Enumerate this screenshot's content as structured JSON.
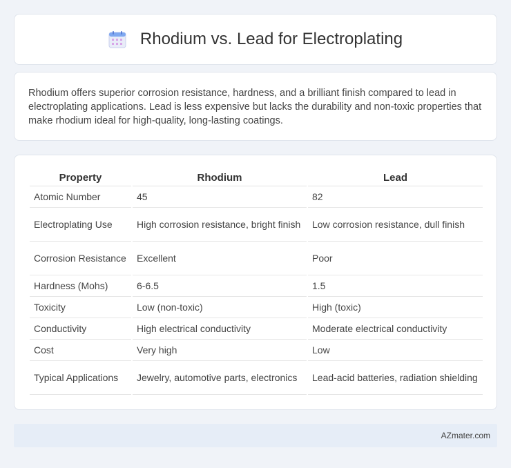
{
  "header": {
    "title": "Rhodium vs. Lead for Electroplating",
    "icon": "calendar-icon"
  },
  "intro": {
    "text": "Rhodium offers superior corrosion resistance, hardness, and a brilliant finish compared to lead in electroplating applications. Lead is less expensive but lacks the durability and non-toxic properties that make rhodium ideal for high-quality, long-lasting coatings."
  },
  "table": {
    "headers": [
      "Property",
      "Rhodium",
      "Lead"
    ],
    "rows": [
      [
        "Atomic Number",
        "45",
        "82"
      ],
      [
        "Electroplating Use",
        "High corrosion resistance, bright finish",
        "Low corrosion resistance, dull finish"
      ],
      [
        "Corrosion Resistance",
        "Excellent",
        "Poor"
      ],
      [
        "Hardness (Mohs)",
        "6-6.5",
        "1.5"
      ],
      [
        "Toxicity",
        "Low (non-toxic)",
        "High (toxic)"
      ],
      [
        "Conductivity",
        "High electrical conductivity",
        "Moderate electrical conductivity"
      ],
      [
        "Cost",
        "Very high",
        "Low"
      ],
      [
        "Typical Applications",
        "Jewelry, automotive parts, electronics",
        "Lead-acid batteries, radiation shielding"
      ]
    ]
  },
  "footer": {
    "text": "AZmater.com"
  },
  "colors": {
    "background": "#f0f3f8",
    "card": "#ffffff",
    "footer": "#e6edf7"
  }
}
